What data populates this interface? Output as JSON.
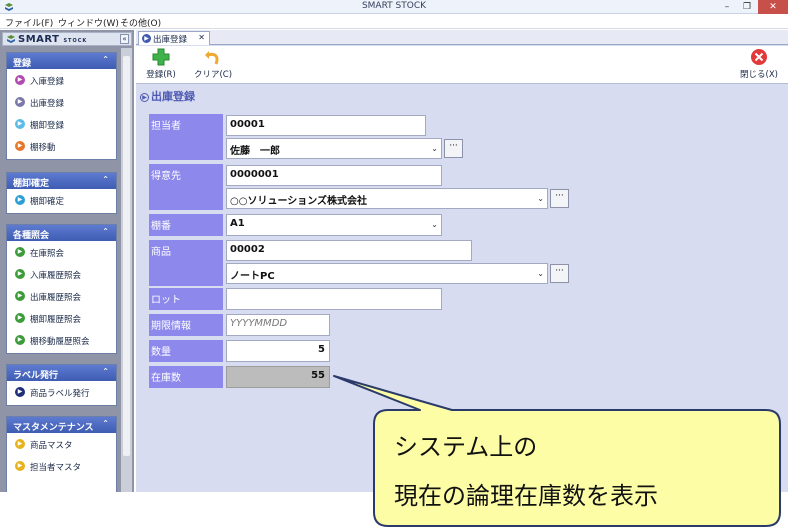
{
  "window": {
    "title": "SMART STOCK",
    "min": "–",
    "max": "❐",
    "close": "✕"
  },
  "menu": [
    "ファイル(F)",
    "ウィンドウ(W)",
    "その他(O)"
  ],
  "sidebar": {
    "logo": "SMART",
    "logo_small": "STOCK",
    "collapse": "«",
    "groups": [
      {
        "title": "登録",
        "items": [
          "入庫登録",
          "出庫登録",
          "棚卸登録",
          "棚移動"
        ]
      },
      {
        "title": "棚卸確定",
        "items": [
          "棚卸確定"
        ]
      },
      {
        "title": "各種照会",
        "items": [
          "在庫照会",
          "入庫履歴照会",
          "出庫履歴照会",
          "棚卸履歴照会",
          "棚移動履歴照会"
        ]
      },
      {
        "title": "ラベル発行",
        "items": [
          "商品ラベル発行"
        ]
      },
      {
        "title": "マスタメンテナンス",
        "items": [
          "商品マスタ",
          "担当者マスタ"
        ]
      }
    ],
    "chevron": "⌃"
  },
  "tab": {
    "label": "出庫登録",
    "close": "✕"
  },
  "toolbar": {
    "register": "登録(R)",
    "clear": "クリア(C)",
    "close": "閉じる(X)"
  },
  "section_title": "出庫登録",
  "form": {
    "staff_label": "担当者",
    "staff_code": "00001",
    "staff_name": "佐藤　一郎",
    "customer_label": "得意先",
    "customer_code": "0000001",
    "customer_name": "○○ソリューションズ株式会社",
    "shelf_label": "棚番",
    "shelf_value": "A1",
    "product_label": "商品",
    "product_code": "00002",
    "product_name": "ノートPC",
    "lot_label": "ロット",
    "lot_value": "",
    "expiry_label": "期限情報",
    "expiry_placeholder": "YYYYMMDD",
    "qty_label": "数量",
    "qty_value": "5",
    "stock_label": "在庫数",
    "stock_value": "55",
    "more": "···",
    "dropdown": "⌄"
  },
  "callout": {
    "line1": "システム上の",
    "line2": "現在の論理在庫数を表示"
  },
  "colors": {
    "label_bg": "#8d89ec",
    "group_header": "#4a68c2",
    "callout_fill": "#fdfda6",
    "callout_border": "#2a3a6a"
  }
}
